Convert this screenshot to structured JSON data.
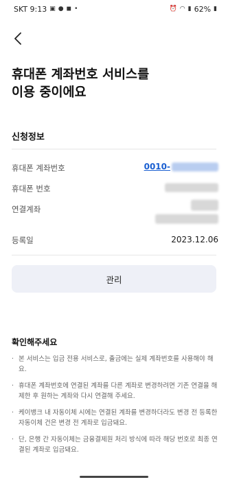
{
  "status_bar": {
    "carrier_time": "SKT 9:13",
    "battery": "62%"
  },
  "header": {
    "title_line1": "휴대폰 계좌번호 서비스를",
    "title_line2": "이용 중이에요"
  },
  "info": {
    "section_title": "신청정보",
    "rows": [
      {
        "label": "휴대폰 계좌번호",
        "value": "0010-"
      },
      {
        "label": "휴대폰 번호",
        "value": ""
      },
      {
        "label": "연결계좌",
        "value": ""
      },
      {
        "label": "등록일",
        "value": "2023.12.06"
      }
    ]
  },
  "manage_button": "관리",
  "notice": {
    "title": "확인해주세요",
    "items": [
      "본 서비스는 입금 전용 서비스로, 출금에는 실제 계좌번호를 사용해야 해요.",
      "휴대폰 계좌번호에 연결된 계좌를 다른 계좌로 변경하려면 기존 연결을 해제한 후 원하는 계좌와 다시 연결해 주세요.",
      "케이뱅크 내 자동이체 시에는 연결된 계좌를 변경하더라도 변경 전 등록한 자동이체 건은 변경 전 계좌로 입금돼요.",
      "단, 은행 간 자동이체는 금융결제원 처리 방식에 따라 해당 번호로 최종 연결된 계좌로 입금돼요."
    ]
  }
}
